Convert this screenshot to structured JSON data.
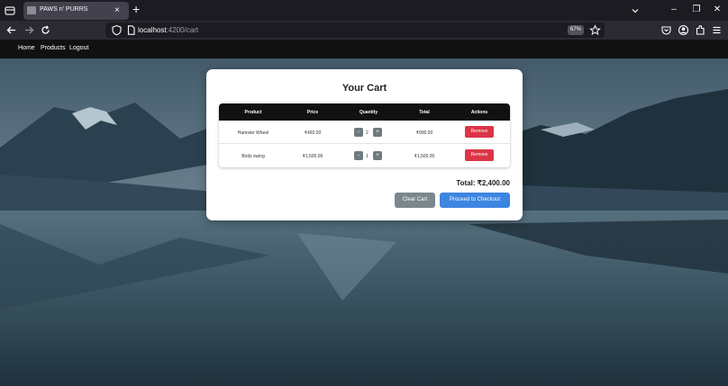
{
  "browser": {
    "tab": {
      "title": "PAWS n' PURRS",
      "close": "×"
    },
    "new_tab": "+",
    "url": {
      "host": "localhost",
      "path": ":4200/cart"
    },
    "zoom": "67%",
    "window": {
      "minimize": "–",
      "restore": "❐",
      "close": "✕"
    }
  },
  "app_nav": {
    "items": [
      "Home",
      "Products",
      "Logout"
    ]
  },
  "cart": {
    "title": "Your Cart",
    "columns": [
      "Product",
      "Price",
      "Quantity",
      "Total",
      "Actions"
    ],
    "rows": [
      {
        "product": "Hamster Wheel",
        "price": "₹450.00",
        "quantity": "2",
        "total": "₹900.00",
        "action": "Remove"
      },
      {
        "product": "Birds swing",
        "price": "₹1,500.00",
        "quantity": "1",
        "total": "₹1,500.00",
        "action": "Remove"
      }
    ],
    "qty_minus": "-",
    "qty_plus": "+",
    "total_label": "Total: ₹2,400.00",
    "clear_label": "Clear Cart",
    "checkout_label": "Proceed to Checkout"
  },
  "colors": {
    "accent_blue": "#3d86e0",
    "danger_red": "#dc3545",
    "neutral_gray": "#7c878c",
    "table_header": "#111111"
  },
  "icons": [
    "tab-list-icon",
    "favicon-icon",
    "back-arrow-icon",
    "forward-arrow-icon",
    "reload-icon",
    "tracking-protection-icon",
    "page-icon",
    "bookmark-star-icon",
    "pocket-icon",
    "account-icon",
    "extensions-icon",
    "menu-icon",
    "tabs-dropdown-icon"
  ]
}
